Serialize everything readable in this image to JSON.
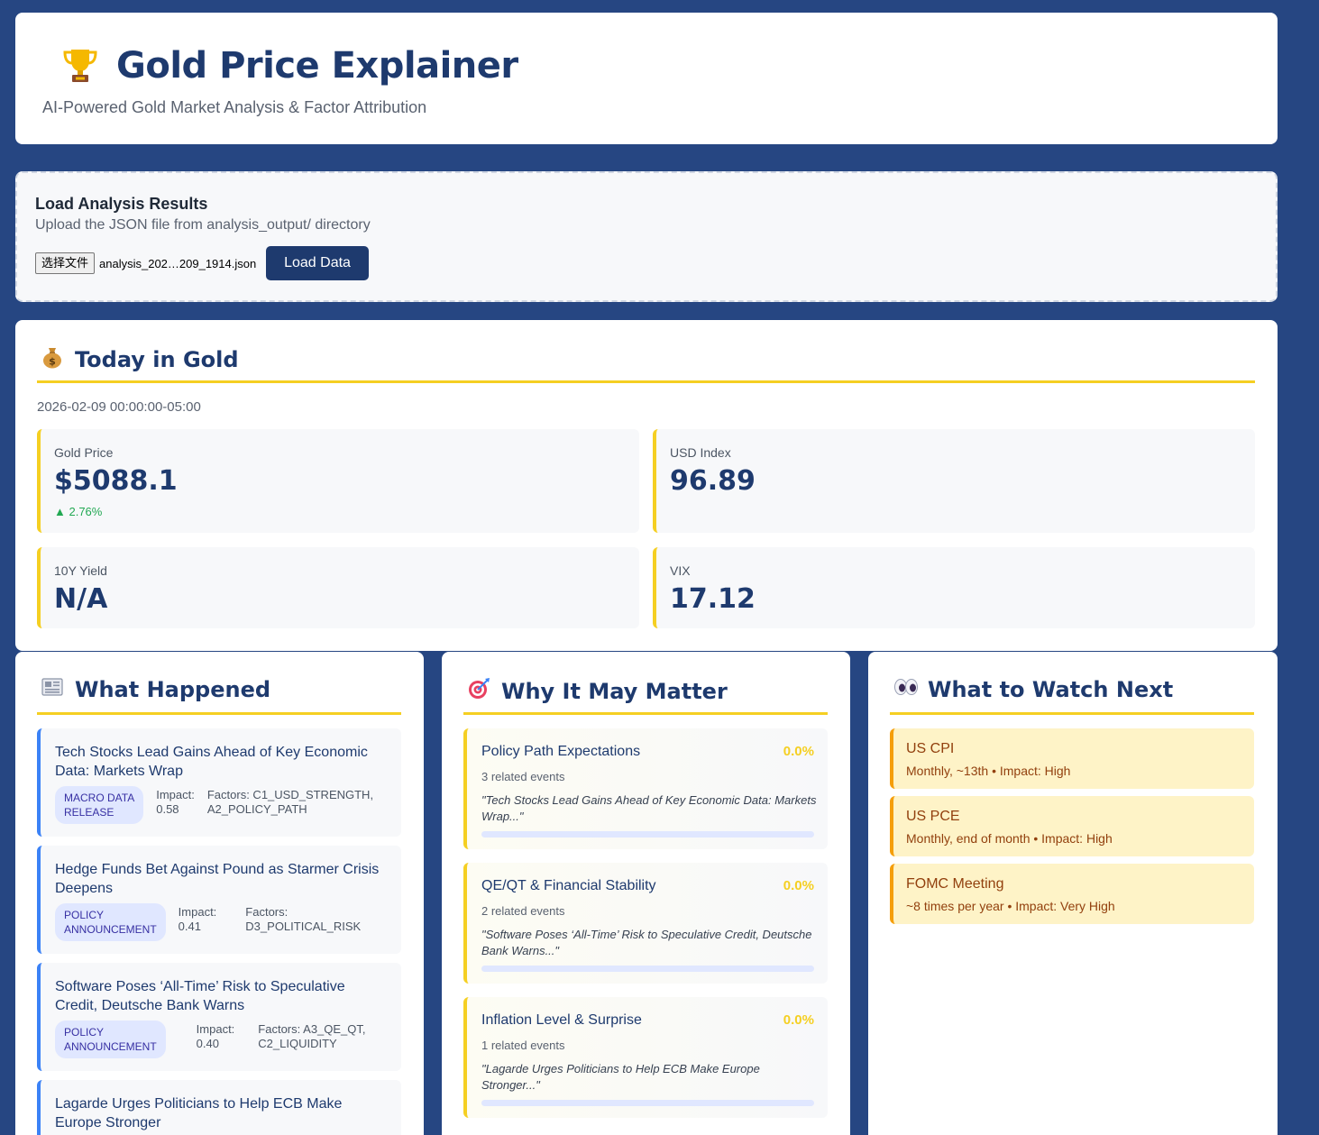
{
  "header": {
    "title": "Gold Price Explainer",
    "subtitle": "AI-Powered Gold Market Analysis & Factor Attribution",
    "icon": "trophy-icon"
  },
  "loader": {
    "title": "Load Analysis Results",
    "description": "Upload the JSON file from analysis_output/ directory",
    "file_button": "选择文件",
    "file_name": "analysis_202…209_1914.json",
    "load_button": "Load Data"
  },
  "today": {
    "heading": "Today in Gold",
    "icon": "money-bag-icon",
    "date": "2026-02-09 00:00:00-05:00",
    "metrics": [
      {
        "label": "Gold Price",
        "value": "$5088.1",
        "change": "▲ 2.76%"
      },
      {
        "label": "USD Index",
        "value": "96.89"
      },
      {
        "label": "10Y Yield",
        "value": "N/A"
      },
      {
        "label": "VIX",
        "value": "17.12"
      }
    ]
  },
  "happened": {
    "heading": "What Happened",
    "icon": "newspaper-icon",
    "items": [
      {
        "title": "Tech Stocks Lead Gains Ahead of Key Economic Data: Markets Wrap",
        "badge_l1": "MACRO DATA",
        "badge_l2": "RELEASE",
        "impact_l1": "Impact:",
        "impact_l2": "0.58",
        "factors_l1": "Factors: C1_USD_STRENGTH,",
        "factors_l2": "A2_POLICY_PATH"
      },
      {
        "title": "Hedge Funds Bet Against Pound as Starmer Crisis Deepens",
        "badge_l1": "POLICY",
        "badge_l2": "ANNOUNCEMENT",
        "impact_l1": "Impact:",
        "impact_l2": "0.41",
        "factors_l1": "Factors:",
        "factors_l2": "D3_POLITICAL_RISK"
      },
      {
        "title": "Software Poses ‘All-Time’ Risk to Speculative Credit, Deutsche Bank Warns",
        "badge_l1": "POLICY",
        "badge_l2": "ANNOUNCEMENT",
        "impact_l1": "Impact:",
        "impact_l2": "0.40",
        "factors_l1": "Factors: A3_QE_QT,",
        "factors_l2": "C2_LIQUIDITY"
      },
      {
        "title": "Lagarde Urges Politicians to Help ECB Make Europe Stronger"
      }
    ]
  },
  "matter": {
    "heading": "Why It May Matter",
    "icon": "target-icon",
    "factors": [
      {
        "name": "Policy Path Expectations",
        "pct": "0.0%",
        "count": "3 related events",
        "quote": "\"Tech Stocks Lead Gains Ahead of Key Economic Data: Markets Wrap...\"",
        "share": 0
      },
      {
        "name": "QE/QT & Financial Stability",
        "pct": "0.0%",
        "count": "2 related events",
        "quote": "\"Software Poses ‘All-Time’ Risk to Speculative Credit, Deutsche Bank Warns...\"",
        "share": 0
      },
      {
        "name": "Inflation Level & Surprise",
        "pct": "0.0%",
        "count": "1 related events",
        "quote": "\"Lagarde Urges Politicians to Help ECB Make Europe Stronger...\"",
        "share": 0
      }
    ]
  },
  "watch": {
    "heading": "What to Watch Next",
    "icon": "eyes-icon",
    "items": [
      {
        "name": "US CPI",
        "detail": "Monthly, ~13th • Impact: High"
      },
      {
        "name": "US PCE",
        "detail": "Monthly, end of month • Impact: High"
      },
      {
        "name": "FOMC Meeting",
        "detail": "~8 times per year • Impact: Very High"
      }
    ]
  },
  "colors": {
    "background": "#264682",
    "primary": "#1e3a6e",
    "accent": "#f5cf22",
    "positive": "#22a853",
    "news_border": "#3b82f6",
    "watch_bg": "#fef3c7"
  }
}
